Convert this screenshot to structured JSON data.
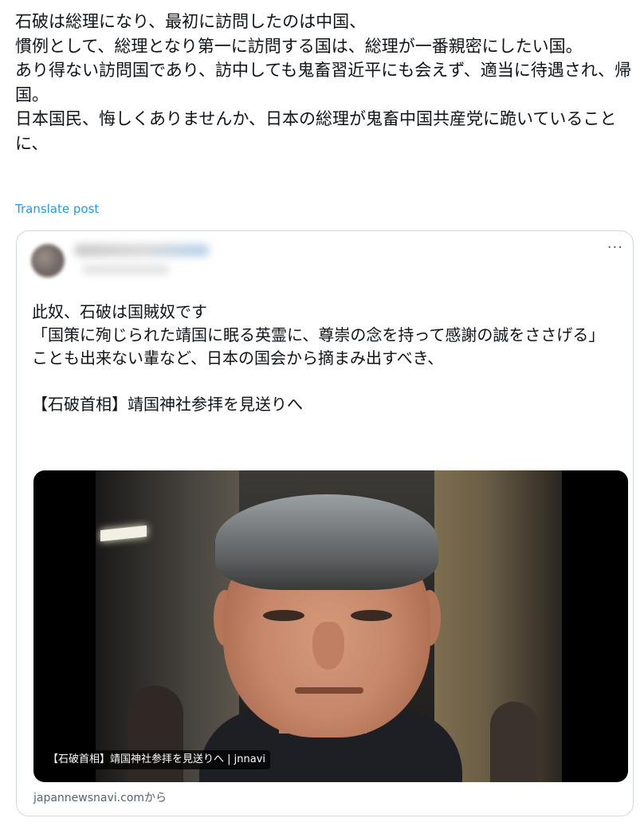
{
  "post": {
    "text": "石破は総理になり、最初に訪問したのは中国、\n慣例として、総理となり第一に訪問する国は、総理が一番親密にしたい国。\nあり得ない訪問国であり、訪中しても鬼畜習近平にも会えず、適当に待遇され、帰国。\n日本国民、悔しくありませんか、日本の総理が鬼畜中国共産党に跪いていることに、",
    "translate_label": "Translate post"
  },
  "quote": {
    "more_label": "···",
    "text": "此奴、石破は国賊奴です\n「国策に殉じられた靖国に眠る英霊に、尊崇の念を持って感謝の誠をささげる」\nことも出来ない輩など、日本の国会から摘まみ出すべき、\n\n【石破首相】靖国神社参拝を見送りへ",
    "link_card": {
      "caption": "【石破首相】靖国神社参拝を見送りへ | jnnavi",
      "source": "japannewsnavi.comから"
    }
  }
}
